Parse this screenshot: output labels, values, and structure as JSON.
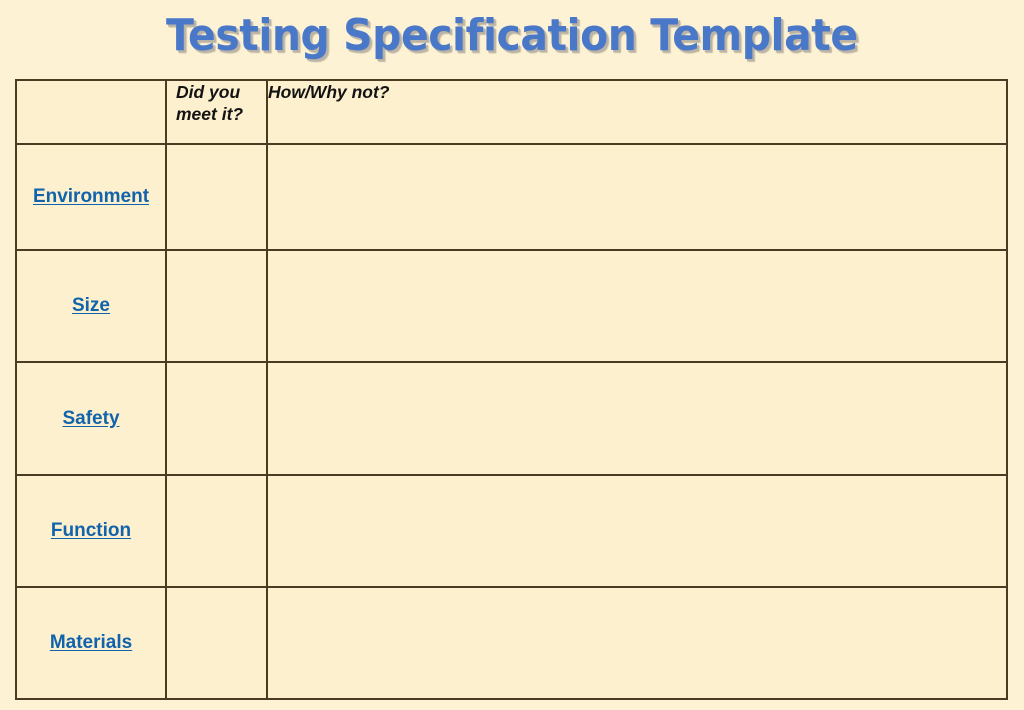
{
  "page": {
    "title": "Testing Specification Template",
    "background_color": "#fdf2d4",
    "cell_background_color": "#fdf0ce",
    "border_color": "#4a3b22",
    "title_color": "#4a78c8",
    "link_color": "#1163ac"
  },
  "table": {
    "headers": {
      "criteria": "",
      "met": "Did you meet it?",
      "reason": "How/Why not?"
    },
    "rows": [
      {
        "label": "Environment",
        "met": "",
        "reason": ""
      },
      {
        "label": "Size",
        "met": "",
        "reason": ""
      },
      {
        "label": "Safety",
        "met": "",
        "reason": ""
      },
      {
        "label": "Function",
        "met": "",
        "reason": ""
      },
      {
        "label": "Materials",
        "met": "",
        "reason": ""
      }
    ]
  }
}
